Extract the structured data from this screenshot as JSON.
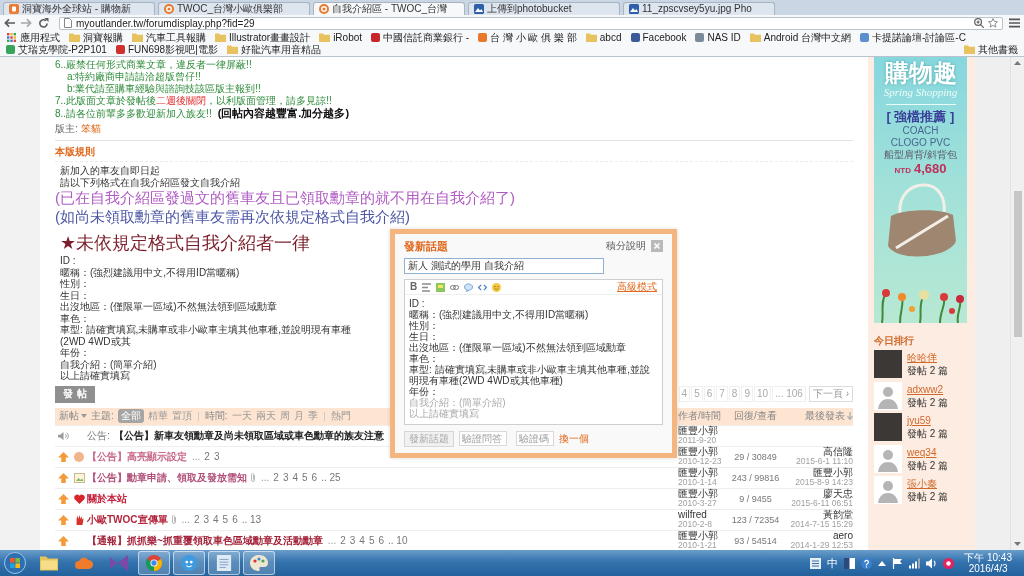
{
  "browser": {
    "tabs": [
      {
        "title": "洞寶海外全球站 - 購物新",
        "kind": "shop",
        "selected": false
      },
      {
        "title": "TWOC_台灣小歐俱樂部",
        "kind": "forum",
        "selected": false
      },
      {
        "title": "自我介紹區 - TWOC_台灣",
        "kind": "forum",
        "selected": true
      },
      {
        "title": "上傳到photobucket",
        "kind": "photo",
        "selected": false
      },
      {
        "title": "11_zpscvsey5yu.jpg Pho",
        "kind": "photo",
        "selected": false
      }
    ],
    "url": "myoutlander.tw/forumdisplay.php?fid=29",
    "bookmarks": [
      {
        "label": "應用程式",
        "kind": "apps"
      },
      {
        "label": "洞寶報購",
        "kind": "folder"
      },
      {
        "label": "汽車工具報購",
        "kind": "folder"
      },
      {
        "label": "Illustrator畫畫設計",
        "kind": "folder"
      },
      {
        "label": "iRobot",
        "kind": "folder"
      },
      {
        "label": "中國信託商業銀行 -",
        "kind": "site",
        "color": "#c8242b"
      },
      {
        "label": "台 灣 小 歐 俱 樂 部",
        "kind": "site",
        "color": "#e8782a"
      },
      {
        "label": "abcd",
        "kind": "folder"
      },
      {
        "label": "Facebook",
        "kind": "site",
        "color": "#3b5998"
      },
      {
        "label": "NAS ID",
        "kind": "site",
        "color": "#7a8a99"
      },
      {
        "label": "Android 台灣中文網",
        "kind": "folder"
      },
      {
        "label": "卡提諾論壇-討論區-C",
        "kind": "site",
        "color": "#5a8fd0"
      },
      {
        "label": "艾瑞克學院-P2P101",
        "kind": "site",
        "color": "#3aa35a"
      },
      {
        "label": "FUN698影視吧|電影",
        "kind": "site",
        "color": "#d0312d"
      },
      {
        "label": "好龍汽車用音精品",
        "kind": "folder"
      }
    ],
    "other_bookmarks": "其他書籤"
  },
  "forum": {
    "notices": [
      {
        "segments": [
          {
            "text": "6..嚴禁任何形式商業文章，違反者一律屏蔽!!",
            "kind": "plain"
          }
        ],
        "children": [
          {
            "segments": [
              {
                "text": "a:特約廠商申請請洽超版曾仔!!",
                "kind": "plain"
              }
            ]
          },
          {
            "segments": [
              {
                "text": "b:業代請至購車經驗與諮詢技該區版主報到!!",
                "kind": "plain"
              }
            ]
          }
        ]
      },
      {
        "segments": [
          {
            "text": "7..此版面文章於發帖後",
            "kind": "plain"
          },
          {
            "text": "二週後關閉",
            "kind": "alert"
          },
          {
            "text": "，以利版面管理，請多見諒!!",
            "kind": "plain"
          }
        ]
      },
      {
        "segments": [
          {
            "text": "8..請各位前輩多多歡迎新加入族友!!",
            "kind": "plain"
          },
          {
            "text": "(回帖內容越豐富.加分越多)",
            "kind": "strong"
          }
        ]
      }
    ],
    "moderator": {
      "label": "版主:",
      "name": "笨貓"
    },
    "rules_title": "本版規則",
    "intro": [
      "新加入的車友自即日起",
      "請以下列格式在自我介紹區發文自我介紹"
    ],
    "notes": [
      "(已在自我介紹區發過文的舊車友且已領取勳章的就不用在自我介紹了)",
      "(如尚未領取勳章的舊車友需再次依規定格式自我介紹)"
    ],
    "warning": "★未依規定格式自我介紹者一律",
    "template": [
      "ID :",
      "暱稱：(強烈建議用中文,不得用ID當暱稱)",
      "性別：",
      "生日：",
      "出沒地區：(僅限單一區域)不然無法領到區域勳章",
      "車色：",
      "車型: 請確實填寫,未購車或非小歐車主填其他車種,並說明現有車種(2WD 4WD或其",
      "年份：",
      "自我介紹：(簡單介紹)",
      "以上請確實填寫"
    ],
    "post_button": "發帖",
    "pagination": {
      "pages": [
        "4",
        "5",
        "6",
        "7",
        "8",
        "9",
        "10",
        "... 106"
      ],
      "next": "下一頁 ›"
    },
    "filters": {
      "new_label": "新帖",
      "topic_label": "主題:",
      "topics": [
        {
          "label": "全部",
          "selected": true
        },
        {
          "label": "精華",
          "selected": false
        },
        {
          "label": "置頂",
          "selected": false
        }
      ],
      "time_label": "時間:",
      "times": [
        {
          "label": "一天",
          "selected": false
        },
        {
          "label": "兩天",
          "selected": false
        },
        {
          "label": "周",
          "selected": false
        },
        {
          "label": "月",
          "selected": false
        },
        {
          "label": "季",
          "selected": false
        }
      ],
      "hot_label": "熱門"
    },
    "columns": [
      "作者/時間",
      "回復/查看",
      "最後發表"
    ],
    "threads": [
      {
        "icons": [
          {
            "kind": "speaker"
          }
        ],
        "prefix": "公告:",
        "title": "【公告】新車友領勳章及尚未領取區域或車色勳章的族友注意",
        "color": "#222222",
        "attachment": false,
        "author": "匯豐小郭",
        "date": "2011-9-20"
      },
      {
        "icons": [
          {
            "kind": "pin"
          },
          {
            "kind": "circle"
          }
        ],
        "title": "【公告】高亮顯示設定",
        "color": "#c86a88",
        "attachment": false,
        "pages_lead": "...",
        "pages": [
          "2",
          "3"
        ],
        "author": "匯豐小郭",
        "date": "2010-12-23",
        "counts": "29 / 30849",
        "last_author": "高信隆",
        "last_time": "2015-6-1 11:10"
      },
      {
        "icons": [
          {
            "kind": "pin"
          },
          {
            "kind": "picture"
          }
        ],
        "title": "【公告】勳章申請、領取及發放需知",
        "color": "#b0507a",
        "attachment": true,
        "pages_lead": "...",
        "pages": [
          "2",
          "3",
          "4",
          "5",
          "6",
          ".. 25"
        ],
        "author": "匯豐小郭",
        "date": "2010-1-14",
        "counts": "243 / 99816",
        "last_author": "匯豐小郭",
        "last_time": "2015-8-9 14:23"
      },
      {
        "icons": [
          {
            "kind": "pin"
          },
          {
            "kind": "heart"
          }
        ],
        "title": "關於本站",
        "color": "#c41e3a",
        "attachment": false,
        "author": "匯豐小郭",
        "date": "2010-3-27",
        "counts": "9 / 9455",
        "last_author": "廖天忠",
        "last_time": "2015-6-11 06:51"
      },
      {
        "icons": [
          {
            "kind": "pin"
          },
          {
            "kind": "hand"
          }
        ],
        "title": "小歐TWOC宣傳單",
        "color": "#b3263c",
        "attachment": true,
        "pages_lead": "...",
        "pages": [
          "2",
          "3",
          "4",
          "5",
          "6",
          ".. 13"
        ],
        "author": "wilfred",
        "date": "2010-2-8",
        "counts": "123 / 72354",
        "last_author": "黃韵堂",
        "last_time": "2014-7-15 15:29"
      },
      {
        "icons": [
          {
            "kind": "pin"
          }
        ],
        "title": "【通報】抓抓樂~抓重覆領取車色區域勳章及活動勳章",
        "color": "#a3233a",
        "attachment": false,
        "pages_lead": "...",
        "pages": [
          "2",
          "3",
          "4",
          "5",
          "6",
          ".. 10"
        ],
        "author": "匯豐小郭",
        "date": "2010-1-21",
        "counts": "93 / 54514",
        "last_author": "aero",
        "last_time": "2014-1-29 12:53"
      }
    ]
  },
  "dialog": {
    "title": "發新話題",
    "help_link": "積分說明",
    "subject": "新人 測試的學用 自我介紹",
    "tools": [
      {
        "kind": "bold",
        "label": "B"
      },
      {
        "kind": "size"
      },
      {
        "kind": "color"
      },
      {
        "kind": "link"
      },
      {
        "kind": "quote"
      },
      {
        "kind": "code"
      },
      {
        "kind": "emoji"
      }
    ],
    "advanced_link": "高級模式",
    "body": [
      {
        "text": "ID :",
        "dim": false
      },
      {
        "text": "暱稱：(強烈建議用中文,不得用ID當暱稱)",
        "dim": false
      },
      {
        "text": "性別：",
        "dim": false
      },
      {
        "text": "生日：",
        "dim": false
      },
      {
        "text": "出沒地區：(僅限單一區域)不然無法領到區域勳章",
        "dim": false
      },
      {
        "text": "車色：",
        "dim": false
      },
      {
        "text": "車型: 請確實填寫,未購車或非小歐車主填其他車種,並說明現有車種(2WD 4WD或其他車種)",
        "dim": false
      },
      {
        "text": "年份：",
        "dim": false
      },
      {
        "text": "自我介紹：(簡單介紹)",
        "dim": true
      },
      {
        "text": "以上請確實填寫",
        "dim": true
      }
    ],
    "submit": {
      "label": "發新話題",
      "disabled": true
    },
    "answer_field": {
      "placeholder": "驗證問答"
    },
    "captcha_field": {
      "placeholder": "驗證碼"
    },
    "refresh_link": "換一個"
  },
  "sidebar": {
    "ad": {
      "headline": "購物趣",
      "script": "Spring Shopping",
      "tag": "[ 強檔推薦 ]",
      "brand": "COACH",
      "model": "CLOGO PVC",
      "description": "船型肩背/斜背包",
      "currency": "NTD",
      "price": "4,680"
    },
    "ranking_title": "今日排行",
    "users": [
      {
        "name": "哈哈佯",
        "posts": "發帖 2 篇",
        "kind": "photo"
      },
      {
        "name": "adxww2",
        "posts": "發帖 2 篇",
        "kind": "default"
      },
      {
        "name": "jyu59",
        "posts": "發帖 2 篇",
        "kind": "photo"
      },
      {
        "name": "weq34",
        "posts": "發帖 2 篇",
        "kind": "default"
      },
      {
        "name": "張小秦",
        "posts": "發帖 2 篇",
        "kind": "default"
      }
    ]
  },
  "taskbar": {
    "apps": [
      {
        "kind": "explorer",
        "running": false
      },
      {
        "kind": "cloud",
        "running": false
      },
      {
        "kind": "studio",
        "running": false
      },
      {
        "kind": "chrome",
        "running": true
      },
      {
        "kind": "messenger",
        "running": true
      },
      {
        "kind": "notepad",
        "running": true
      },
      {
        "kind": "paint",
        "running": true
      }
    ],
    "ime": "中",
    "time": "下午 10:43",
    "date": "2016/4/3"
  }
}
